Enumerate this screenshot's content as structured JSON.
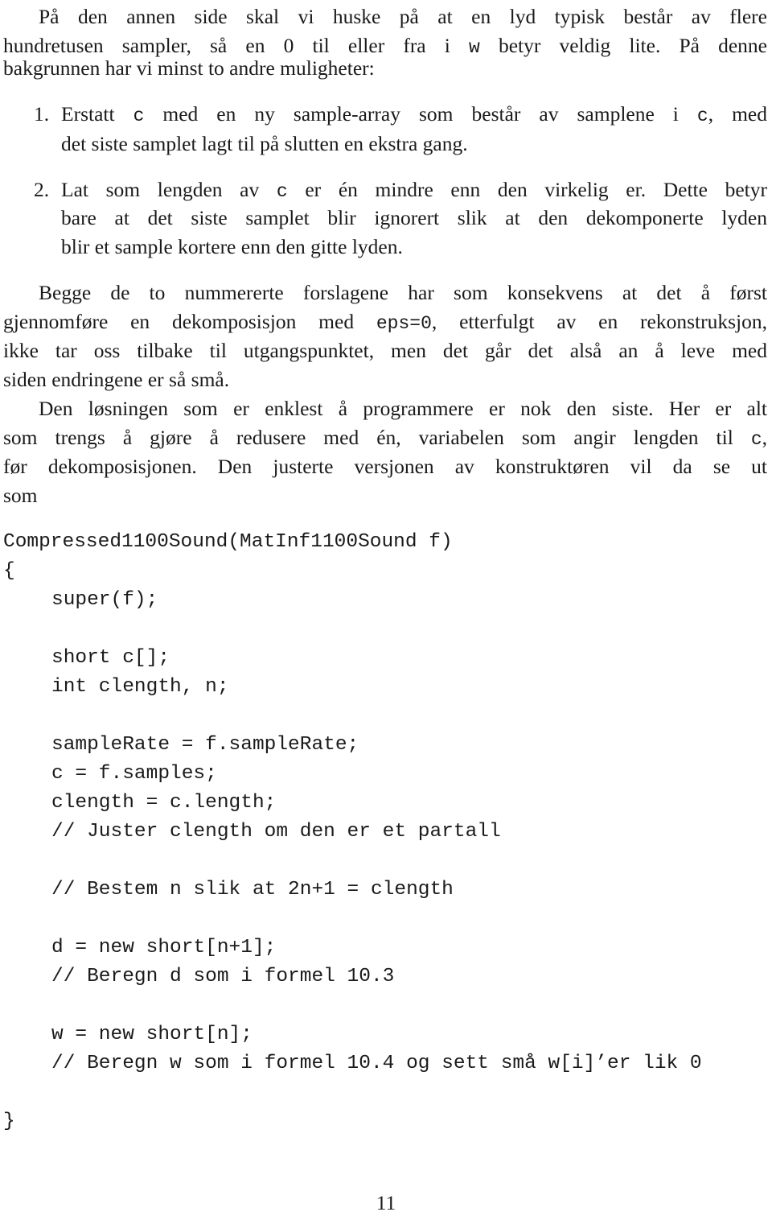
{
  "paragraph1": {
    "lines": [
      "På den annen side skal vi huske på at en lyd typisk består av flere",
      [
        "hundretusen sampler, så en 0 til eller fra i ",
        "w",
        " betyr veldig lite. På denne"
      ],
      "bakgrunnen har vi minst to andre muligheter:"
    ]
  },
  "list": {
    "items": [
      {
        "number": "1.",
        "line1": [
          "Erstatt ",
          "c",
          " med en ny sample-array som består av samplene i ",
          "c",
          ", med"
        ],
        "line2": "det siste samplet lagt til på slutten en ekstra gang."
      },
      {
        "number": "2.",
        "line1": [
          "Lat som lengden av ",
          "c",
          " er én mindre enn den virkelig er. Dette betyr"
        ],
        "line2": "bare at det siste samplet blir ignorert slik at den dekomponerte lyden",
        "line3": "blir et sample kortere enn den gitte lyden."
      }
    ]
  },
  "paragraph2": {
    "lines": [
      "Begge de to nummererte forslagene har som konsekvens at det å først",
      [
        "gjennomføre en dekomposisjon med ",
        "eps=0",
        ", etterfulgt av en rekonstruksjon,"
      ],
      "ikke tar oss tilbake til utgangspunktet, men det går det alså an å leve med",
      "siden endringene er så små."
    ]
  },
  "paragraph3": {
    "lines": [
      "Den løsningen som er enklest å programmere er nok den siste. Her er alt",
      [
        "som trengs å gjøre å redusere med én, variabelen som angir lengden til ",
        "c",
        ","
      ],
      "før dekomposisjonen. Den justerte versjonen av konstruktøren vil da se ut",
      "som"
    ]
  },
  "code": {
    "lines": [
      "Compressed1100Sound(MatInf1100Sound f)",
      "{",
      "super(f);",
      "short c[];",
      "int clength, n;",
      "sampleRate = f.sampleRate;",
      "c = f.samples;",
      "clength = c.length;",
      "// Juster clength om den er et partall",
      "// Bestem n slik at 2n+1 = clength",
      "d = new short[n+1];",
      "// Beregn d som i formel 10.3",
      "w = new short[n];",
      "// Beregn w som i formel 10.4 og sett små w[i]’er lik 0",
      "}"
    ]
  },
  "footer": {
    "page_number": "11"
  }
}
